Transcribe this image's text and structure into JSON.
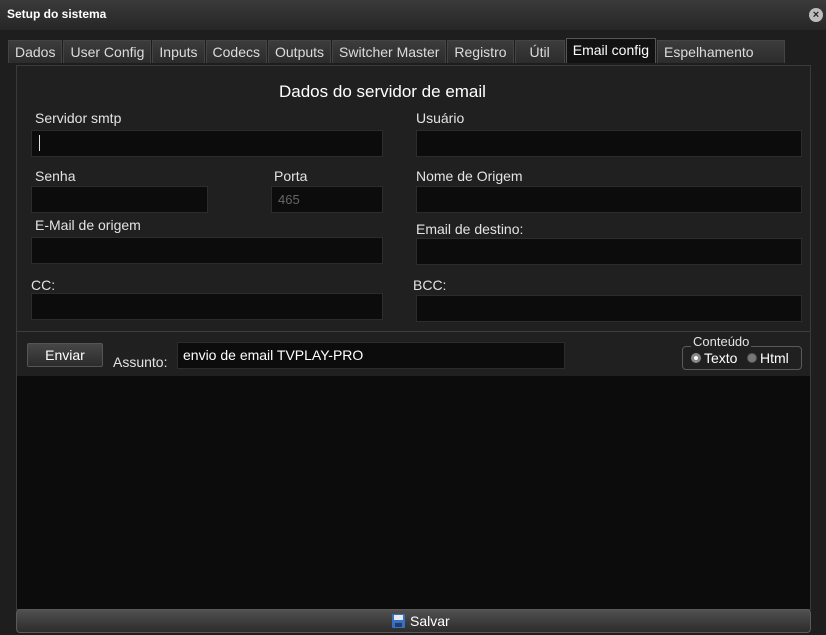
{
  "window": {
    "title": "Setup do sistema",
    "close_glyph": "×"
  },
  "tabs": [
    {
      "label": "Dados"
    },
    {
      "label": "User Config"
    },
    {
      "label": "Inputs"
    },
    {
      "label": "Codecs"
    },
    {
      "label": "Outputs"
    },
    {
      "label": "Switcher Master"
    },
    {
      "label": "Registro"
    },
    {
      "label": "Útil"
    },
    {
      "label": "Email config"
    },
    {
      "label": "Espelhamento"
    }
  ],
  "active_tab": "Email config",
  "section_title": "Dados do servidor de email",
  "form": {
    "servidor_smtp": {
      "label": "Servidor smtp",
      "value": ""
    },
    "usuario": {
      "label": "Usuário",
      "value": ""
    },
    "senha": {
      "label": "Senha",
      "value": ""
    },
    "porta": {
      "label": "Porta",
      "value": "465"
    },
    "nome_origem": {
      "label": "Nome de Origem",
      "value": ""
    },
    "email_origem": {
      "label": "E-Mail  de origem",
      "value": ""
    },
    "email_destino": {
      "label": "Email de destino:",
      "value": ""
    },
    "cc": {
      "label": "CC:",
      "value": ""
    },
    "bcc": {
      "label": "BCC:",
      "value": ""
    }
  },
  "actions": {
    "enviar_label": "Enviar",
    "assunto_label": "Assunto:",
    "assunto_value": "envio de email TVPLAY-PRO"
  },
  "conteudo": {
    "legend": "Conteúdo",
    "options": [
      "Texto",
      "Html"
    ],
    "selected": "Texto"
  },
  "footer": {
    "save_label": "Salvar"
  },
  "icons": {
    "close": "close-icon",
    "save": "save-disk-icon"
  }
}
